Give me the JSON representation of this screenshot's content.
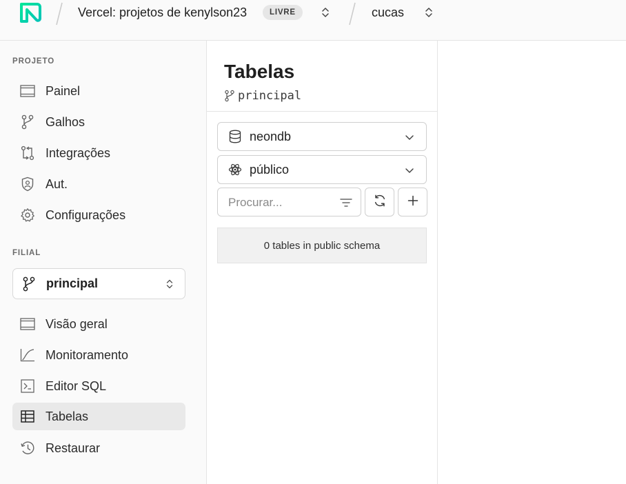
{
  "header": {
    "org_name": "Vercel: projetos de kenylson23",
    "plan_badge": "LIVRE",
    "project_name": "cucas",
    "brand_color": "#00e699"
  },
  "sidebar": {
    "project_section_label": "PROJETO",
    "project_items": [
      {
        "label": "Painel",
        "icon": "dashboard-icon"
      },
      {
        "label": "Galhos",
        "icon": "branch-icon"
      },
      {
        "label": "Integrações",
        "icon": "integrations-icon"
      },
      {
        "label": "Aut.",
        "icon": "shield-icon"
      },
      {
        "label": "Configurações",
        "icon": "gear-icon"
      }
    ],
    "branch_section_label": "FILIAL",
    "branch_selector": {
      "label": "principal",
      "icon": "branch-icon"
    },
    "branch_items": [
      {
        "label": "Visão geral",
        "icon": "overview-icon"
      },
      {
        "label": "Monitoramento",
        "icon": "monitoring-icon"
      },
      {
        "label": "Editor SQL",
        "icon": "terminal-icon"
      },
      {
        "label": "Tabelas",
        "icon": "table-icon",
        "active": true
      },
      {
        "label": "Restaurar",
        "icon": "history-icon"
      }
    ]
  },
  "tables_panel": {
    "title": "Tabelas",
    "branch": "principal",
    "database_select": {
      "value": "neondb",
      "icon": "database-icon"
    },
    "schema_select": {
      "value": "público",
      "icon": "schema-icon"
    },
    "search": {
      "placeholder": "Procurar..."
    },
    "empty_message": "0 tables in public schema"
  }
}
